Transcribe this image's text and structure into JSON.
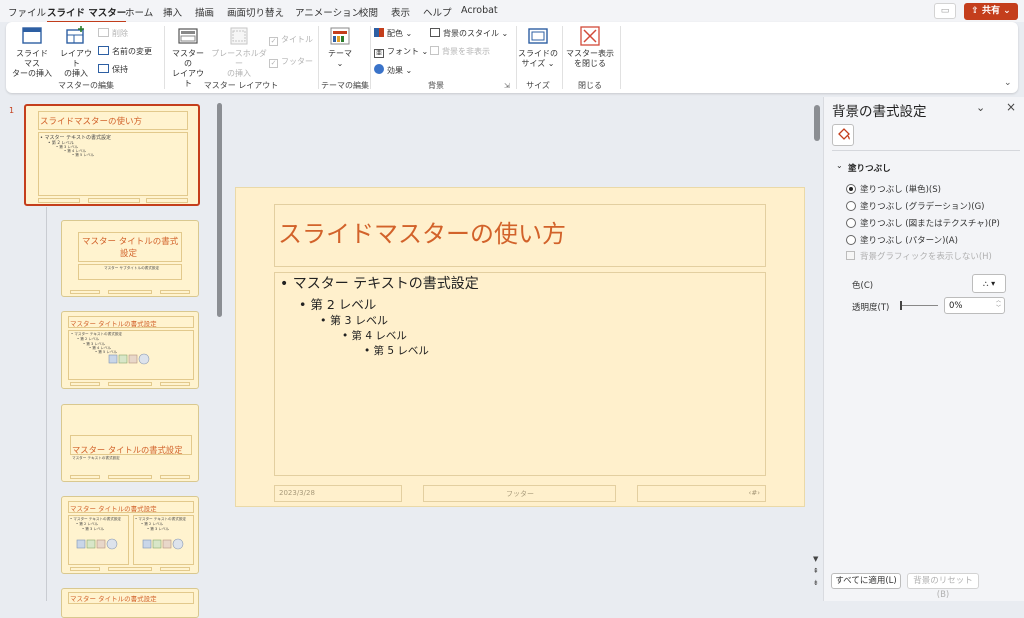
{
  "tabs": [
    "ファイル",
    "スライド マスター",
    "ホーム",
    "挿入",
    "描画",
    "画面切り替え",
    "アニメーション",
    "校閲",
    "表示",
    "ヘルプ",
    "Acrobat"
  ],
  "share_label": "共有",
  "ribbon": {
    "groups": {
      "master_edit": "マスターの編集",
      "master_layout": "マスター レイアウト",
      "theme_edit": "テーマの編集",
      "background": "背景",
      "size": "サイズ",
      "close": "閉じる"
    },
    "insert_slide_master": [
      "スライド マス",
      "ターの挿入"
    ],
    "insert_layout": [
      "レイアウト",
      "の挿入"
    ],
    "delete": "削除",
    "rename": "名前の変更",
    "preserve": "保持",
    "master_layout_btn": [
      "マスターの",
      "レイアウト"
    ],
    "insert_placeholder": [
      "プレースホルダー",
      "の挿入"
    ],
    "title_chk": "タイトル",
    "footer_chk": "フッター",
    "themes": "テーマ",
    "colors": "配色",
    "fonts": "フォント",
    "effects": "効果",
    "bg_styles": "背景のスタイル",
    "hide_bg": "背景を非表示",
    "slide_size": [
      "スライドの",
      "サイズ"
    ],
    "close_master": [
      "マスター表示",
      "を閉じる"
    ]
  },
  "thumbnails": {
    "slide_number": "1",
    "t1_title": "スライドマスターの使い方",
    "t1_lines": [
      "• マスター テキストの書式設定",
      "• 第 2 レベル",
      "• 第 3 レベル",
      "• 第 4 レベル",
      "• 第 5 レベル"
    ],
    "t2_title": [
      "マスター タイトルの書式",
      "設定"
    ],
    "t2_sub": "マスター サブタイトルの書式設定",
    "t3_title": "マスター タイトルの書式設定",
    "t3_lines": [
      "• マスター テキストの書式設定",
      "• 第 2 レベル",
      "• 第 3 レベル",
      "• 第 4 レベル",
      "• 第 5 レベル"
    ],
    "t4_title": "マスター タイトルの書式設定",
    "t4_sub": "マスター テキストの書式設定",
    "t5_title": "マスター タイトルの書式設定",
    "t5_lines_left": [
      "• マスター テキストの書式設定",
      "• 第 2 レベル",
      "• 第 3 レベル"
    ],
    "t5_lines_right": [
      "• マスター テキストの書式設定",
      "• 第 2 レベル",
      "• 第 3 レベル"
    ],
    "t6_title": "マスター タイトルの書式設定"
  },
  "slide": {
    "title": "スライドマスターの使い方",
    "levels": [
      "• マスター テキストの書式設定",
      "• 第 2 レベル",
      "• 第 3 レベル",
      "• 第 4 レベル",
      "• 第 5 レベル"
    ],
    "date": "2023/3/28",
    "footer": "フッター",
    "page": "‹#›"
  },
  "pane": {
    "title": "背景の書式設定",
    "section": "塗りつぶし",
    "options": [
      "塗りつぶし (単色)(S)",
      "塗りつぶし (グラデーション)(G)",
      "塗りつぶし (図またはテクスチャ)(P)",
      "塗りつぶし (パターン)(A)"
    ],
    "hide_graphics": "背景グラフィックを表示しない(H)",
    "color_label": "色(C)",
    "transparency_label": "透明度(T)",
    "transparency_value": "0%",
    "apply_all": "すべてに適用(L)",
    "reset_bg": "背景のリセット(B)"
  }
}
